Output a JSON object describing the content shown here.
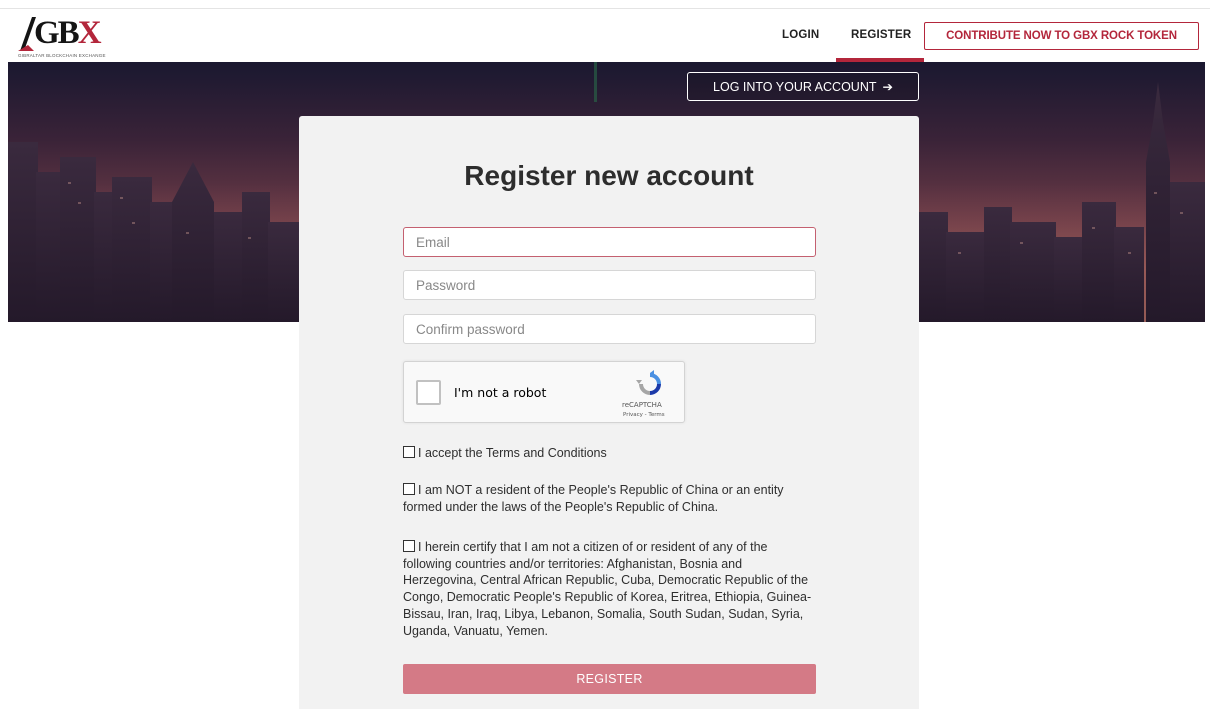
{
  "logo": {
    "text_main": "GB",
    "text_accent": "X",
    "subtitle": "GIBRALTAR BLOCKCHAIN EXCHANGE"
  },
  "nav": {
    "login": "LOGIN",
    "register": "REGISTER",
    "contribute": "CONTRIBUTE NOW TO GBX ROCK TOKEN"
  },
  "hero": {
    "login_button": "LOG INTO YOUR ACCOUNT"
  },
  "form": {
    "title": "Register new account",
    "email_placeholder": "Email",
    "password_placeholder": "Password",
    "confirm_placeholder": "Confirm password",
    "recaptcha": {
      "label": "I'm not a robot",
      "brand": "reCAPTCHA",
      "links": "Privacy - Terms"
    },
    "terms": "I accept the Terms and Conditions",
    "china": "I am NOT a resident of the People's Republic of China or an entity formed under the laws of the People's Republic of China.",
    "sanctions": "I herein certify that I am not a citizen of or resident of any of the following countries and/or territories: Afghanistan, Bosnia and Herzegovina, Central African Republic, Cuba, Democratic Republic of the Congo, Democratic People's Republic of Korea, Eritrea, Ethiopia, Guinea-Bissau, Iran, Iraq, Libya, Lebanon, Somalia, South Sudan, Sudan, Syria, Uganda, Vanuatu, Yemen.",
    "submit": "REGISTER"
  },
  "colors": {
    "brand": "#b3263b",
    "register_button": "#d47a86",
    "card_bg": "#f2f2f2"
  }
}
